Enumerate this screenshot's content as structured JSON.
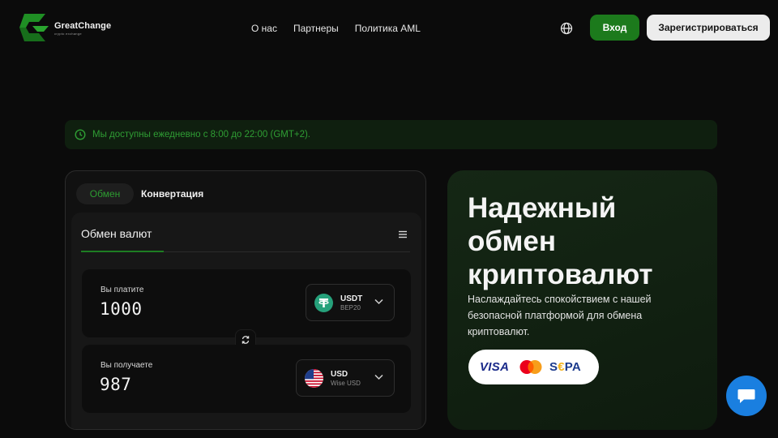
{
  "header": {
    "brand_name": "GreatChange",
    "brand_sub": "crypto exchange",
    "nav": [
      "О нас",
      "Партнеры",
      "Политика AML"
    ],
    "login_label": "Вход",
    "register_label": "Зарегистрироваться"
  },
  "notice": {
    "text": "Мы доступны ежедневно с 8:00 до 22:00 (GMT+2)."
  },
  "exchange": {
    "tabs": [
      "Обмен",
      "Конвертация"
    ],
    "title": "Обмен валют",
    "pay": {
      "label": "Вы платите",
      "value": "1000",
      "currency_code": "USDT",
      "currency_network": "BEP20",
      "icon": "tether-icon"
    },
    "receive": {
      "label": "Вы получаете",
      "value": "987",
      "currency_code": "USD",
      "currency_network": "Wise USD",
      "icon": "us-flag-icon"
    }
  },
  "promo": {
    "title": "Надежный обмен криптовалют",
    "description": "Наслаждайтесь спокойствием с нашей безопасной платформой для обмена криптовалют.",
    "payment_methods": {
      "visa": "VISA",
      "sepa_s": "S",
      "sepa_e": "€",
      "sepa_pa": "PA"
    }
  },
  "colors": {
    "accent_green": "#1c7a1c",
    "notice_green": "#2f9e34",
    "chat_blue": "#1a7fe0",
    "background": "#0b0b0b"
  }
}
